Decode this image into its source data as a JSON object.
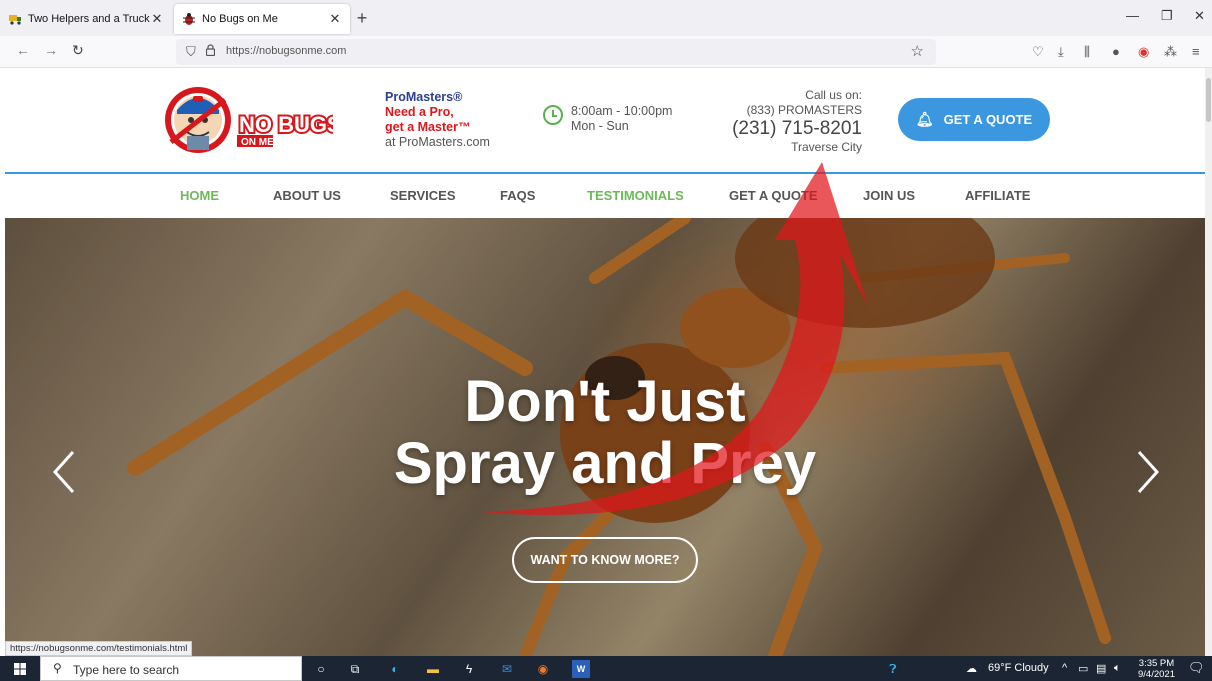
{
  "browser": {
    "tabs": [
      {
        "title": "Two Helpers and a Truck",
        "active": false
      },
      {
        "title": "No Bugs on Me",
        "active": true
      }
    ],
    "url": "https://nobugsonme.com",
    "status_link": "https://nobugsonme.com/testimonials.html"
  },
  "header": {
    "logo_text": "NO BUGS",
    "logo_sub": "ON ME",
    "promasters": {
      "line1": "ProMasters®",
      "line2": "Need a Pro,",
      "line3": "get a Master™",
      "line4": "at ProMasters.com"
    },
    "hours": {
      "time": "8:00am - 10:00pm",
      "days": "Mon - Sun"
    },
    "contact": {
      "call_label": "Call us on:",
      "vanity": "(833) PROMASTERS",
      "phone": "(231) 715-8201",
      "city": "Traverse City"
    },
    "quote_button": "GET A QUOTE"
  },
  "menu": {
    "items": [
      "HOME",
      "ABOUT US",
      "SERVICES",
      "FAQS",
      "TESTIMONIALS",
      "GET A QUOTE",
      "JOIN US",
      "AFFILIATE"
    ],
    "active_colors": {
      "home": "#6fb85a",
      "testimonials": "#6fb85a"
    }
  },
  "hero": {
    "title_line1": "Don't Just",
    "title_line2": "Spray and Prey",
    "button": "WANT TO KNOW MORE?"
  },
  "taskbar": {
    "search_placeholder": "Type here to search",
    "weather": "69°F  Cloudy",
    "time": "3:35 PM",
    "date": "9/4/2021"
  },
  "colors": {
    "accent_blue": "#3b97e0",
    "accent_green": "#6fb85a",
    "brand_red": "#e0161b",
    "annotation_arrow": "#e0161b"
  }
}
